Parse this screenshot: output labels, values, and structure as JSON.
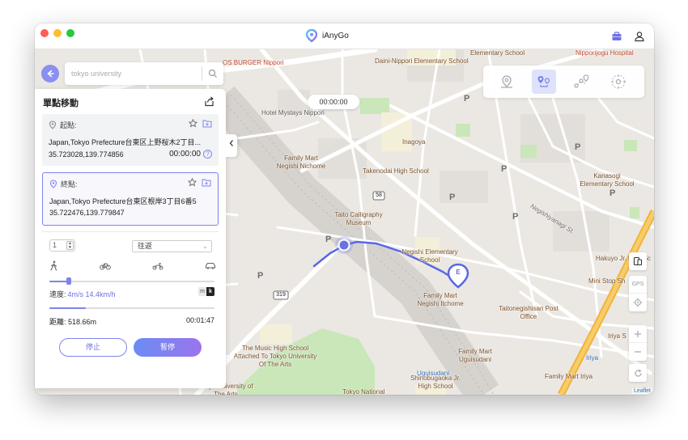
{
  "app": {
    "title": "iAnyGo"
  },
  "search": {
    "placeholder": "tokyo university"
  },
  "panel": {
    "title": "單點移動",
    "start": {
      "label": "起點:",
      "address": "Japan,Tokyo Prefecture台東区上野桜木2丁目...",
      "coords": "35.723028,139.774856",
      "time": "00:00:00"
    },
    "end": {
      "label": "終點:",
      "address": "Japan,Tokyo Prefecture台東区根岸3丁目6番5",
      "coords": "35.722476,139.779847"
    },
    "repeat_count": "1",
    "mode_option": "往返",
    "speed_label": "速度:",
    "speed_value": "4m/s 14.4km/h",
    "speed_fraction": 0.12,
    "unit_off": "m",
    "unit_on": "k",
    "progress_fraction": 0.22,
    "distance_label": "距離:",
    "distance_value": "518.66m",
    "duration": "00:01:47",
    "stop_label": "停止",
    "pause_label": "暫停"
  },
  "map": {
    "timer": "00:00:00",
    "end_marker": "E",
    "attribution": "Leaflet",
    "gps_label": "GPS",
    "labels": [
      "Daini-Nippori Elementary School",
      "Elementary School",
      "Nipporijogu Hospital",
      "OS BURGER Nippori",
      "Hotel Mystays Nippori",
      "Inagoya",
      "Family Mart Negishi Nichome",
      "Takenodai High School",
      "Kanasogi Elementary School",
      "Taito Calligraphy Museum",
      "Negishiyanagi St.",
      "Negishi Elementary School",
      "Hakuyo Jr. High Sc",
      "Mini Stop Sh",
      "Family Mart Negishi Itchome",
      "Taitonegishisan Post Office",
      "The Music High School Attached To Tokyo University Of The Arts",
      "Family Mart Uguisudani",
      "Uguisudani",
      "Iriya S",
      "Iriya",
      "Family Mart Iriya",
      "Tokyo University of The Arts",
      "Shinobugaoka Jr. High School",
      "Tokyo National",
      "58",
      "319"
    ]
  }
}
